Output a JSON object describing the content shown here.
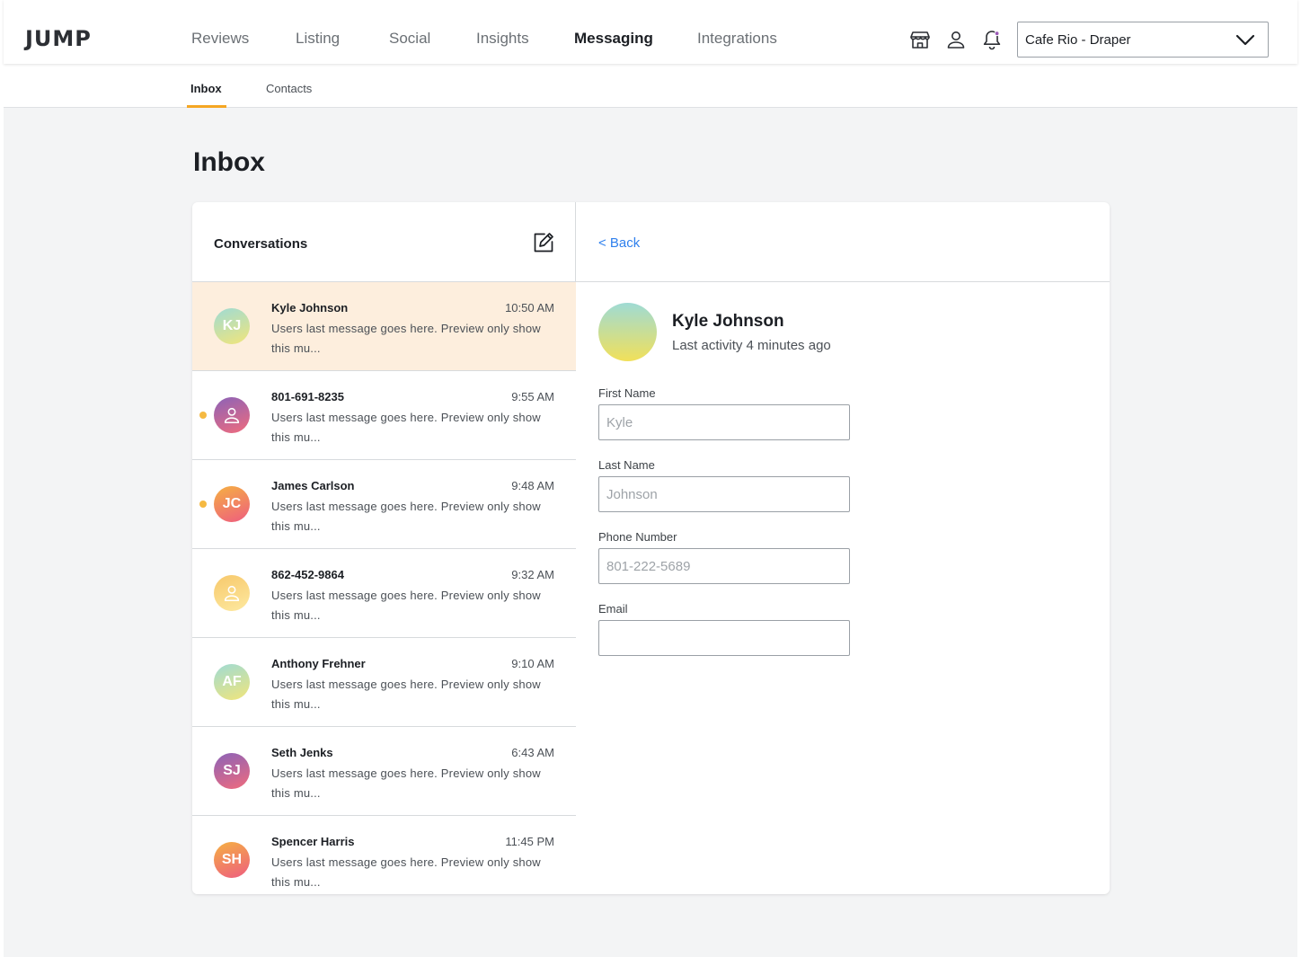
{
  "app": {
    "logo": "JUMP"
  },
  "nav": {
    "items": [
      {
        "label": "Reviews"
      },
      {
        "label": "Listing"
      },
      {
        "label": "Social"
      },
      {
        "label": "Insights"
      },
      {
        "label": "Messaging"
      },
      {
        "label": "Integrations"
      }
    ],
    "active": "Messaging",
    "location_select": "Cafe Rio - Draper"
  },
  "subnav": {
    "tabs": [
      {
        "label": "Inbox"
      },
      {
        "label": "Contacts"
      }
    ],
    "active": "Inbox",
    "accent_color": "#f5a623"
  },
  "page": {
    "title": "Inbox"
  },
  "conversations": {
    "title": "Conversations",
    "items": [
      {
        "name": "Kyle Johnson",
        "initials": "KJ",
        "time": "10:50 AM",
        "preview": "Users last message goes here. Preview only show this mu...",
        "selected": true,
        "unread": false,
        "avatar": "green"
      },
      {
        "name": "801-691-8235",
        "initials": "",
        "time": "9:55 AM",
        "preview": "Users last message goes here. Preview only show this mu...",
        "selected": false,
        "unread": true,
        "avatar": "purple"
      },
      {
        "name": "James Carlson",
        "initials": "JC",
        "time": "9:48 AM",
        "preview": "Users last message goes here. Preview only show this mu...",
        "selected": false,
        "unread": true,
        "avatar": "orange"
      },
      {
        "name": "862-452-9864",
        "initials": "",
        "time": "9:32 AM",
        "preview": "Users last message goes here. Preview only show this mu...",
        "selected": false,
        "unread": false,
        "avatar": "yellow"
      },
      {
        "name": "Anthony Frehner",
        "initials": "AF",
        "time": "9:10 AM",
        "preview": "Users last message goes here. Preview only show this mu...",
        "selected": false,
        "unread": false,
        "avatar": "green"
      },
      {
        "name": "Seth Jenks",
        "initials": "SJ",
        "time": "6:43 AM",
        "preview": "Users last message goes here. Preview only show this mu...",
        "selected": false,
        "unread": false,
        "avatar": "purple"
      },
      {
        "name": "Spencer Harris",
        "initials": "SH",
        "time": "11:45 PM",
        "preview": "Users last message goes here. Preview only show this mu...",
        "selected": false,
        "unread": false,
        "avatar": "orange"
      }
    ]
  },
  "detail": {
    "back_label": "< Back",
    "name": "Kyle Johnson",
    "activity": "Last activity 4 minutes ago",
    "fields": {
      "first_name": {
        "label": "First Name",
        "placeholder": "Kyle"
      },
      "last_name": {
        "label": "Last Name",
        "placeholder": "Johnson"
      },
      "phone": {
        "label": "Phone Number",
        "placeholder": "801-222-5689"
      },
      "email": {
        "label": "Email",
        "placeholder": ""
      }
    }
  },
  "colors": {
    "selected_row": "#fdeedd",
    "unread_dot": "#f5b942",
    "link": "#2f80ed"
  }
}
